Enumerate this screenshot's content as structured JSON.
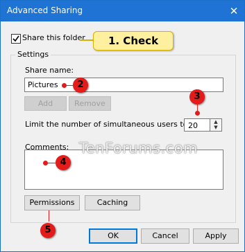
{
  "window": {
    "title": "Advanced Sharing",
    "close_glyph": "✕"
  },
  "share": {
    "checkbox_label": "Share this folder",
    "checked": true
  },
  "settings": {
    "group_label": "Settings",
    "share_name_label": "Share name:",
    "share_name_value": "Pictures",
    "add_label": "Add",
    "remove_label": "Remove",
    "limit_label": "Limit the number of simultaneous users to:",
    "limit_value": "20",
    "comments_label": "Comments:",
    "comments_value": "",
    "permissions_label": "Permissions",
    "caching_label": "Caching"
  },
  "footer": {
    "ok_label": "OK",
    "cancel_label": "Cancel",
    "apply_label": "Apply"
  },
  "annotations": {
    "callout": "1. Check",
    "m2": "2",
    "m3": "3",
    "m4": "4",
    "m5": "5",
    "marker_color": "#e31b1b",
    "callout_color": "#fff0a0"
  },
  "watermark": "TenForums.com",
  "colors": {
    "titlebar": "#1e73d4",
    "window_bg": "#f0f0f0",
    "default_button_border": "#0078d7"
  }
}
